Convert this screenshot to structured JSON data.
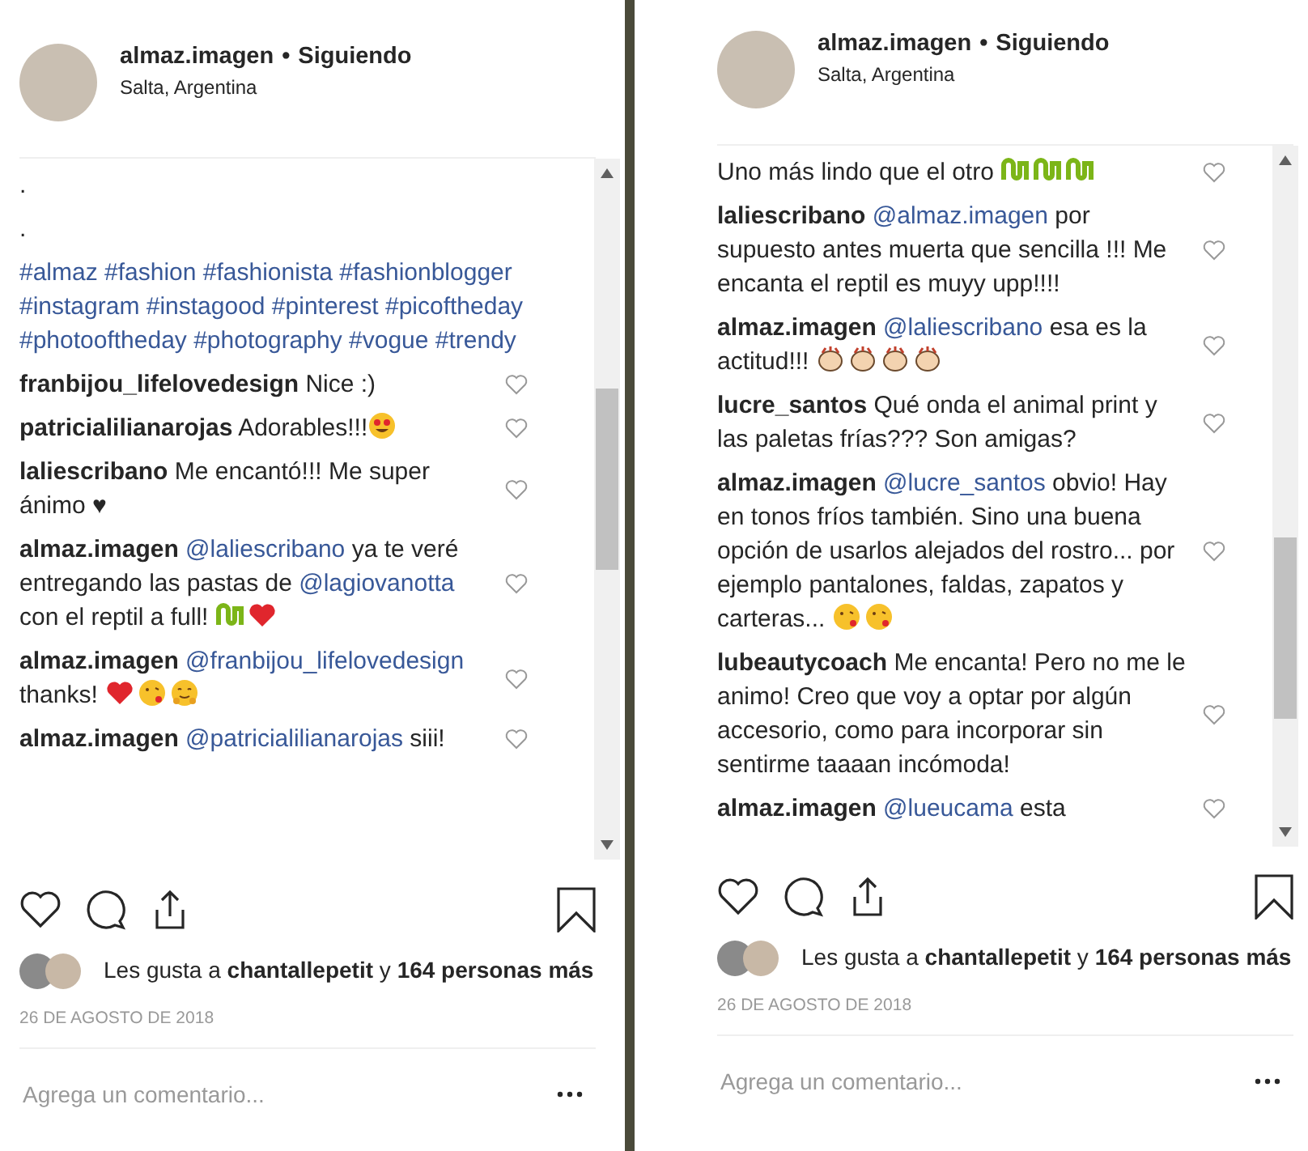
{
  "panels": [
    {
      "header": {
        "username": "almaz.imagen",
        "separator": "•",
        "follow": "Siguiendo",
        "location": "Salta, Argentina"
      },
      "comments": [
        {
          "kind": "caption",
          "parts": [
            {
              "kind": "text",
              "text": "."
            }
          ]
        },
        {
          "kind": "caption",
          "parts": [
            {
              "kind": "text",
              "text": "."
            }
          ]
        },
        {
          "kind": "caption",
          "parts": [
            {
              "kind": "tag",
              "text": "#almaz #fashion #fashionista #fashionblogger #instagram #instagood #pinterest #picoftheday #photooftheday #photography #vogue #trendy"
            }
          ]
        },
        {
          "kind": "comment",
          "user": "franbijou_lifelovedesign",
          "parts": [
            {
              "kind": "text",
              "text": "Nice :)"
            }
          ]
        },
        {
          "kind": "comment",
          "user": "patricialilianarojas",
          "parts": [
            {
              "kind": "text",
              "text": "Adorables!!!"
            }
          ],
          "stickers": [
            {
              "kind": "heart-eyes"
            }
          ]
        },
        {
          "kind": "comment",
          "user": "laliescribano",
          "parts": [
            {
              "kind": "text",
              "text": "Me encantó!!! Me super ánimo ♥"
            }
          ]
        },
        {
          "kind": "comment",
          "user": "almaz.imagen",
          "parts": [
            {
              "kind": "tag",
              "text": "@laliescribano"
            },
            {
              "kind": "text",
              "text": " ya te veré entregando las pastas de "
            },
            {
              "kind": "tag",
              "text": "@lagiovanotta"
            },
            {
              "kind": "text",
              "text": " con el reptil a full! "
            }
          ],
          "stickers": [
            {
              "kind": "snake"
            },
            {
              "kind": "heart"
            }
          ]
        },
        {
          "kind": "comment",
          "user": "almaz.imagen",
          "parts": [
            {
              "kind": "tag",
              "text": "@franbijou_lifelovedesign"
            },
            {
              "kind": "text",
              "text": " thanks! "
            }
          ],
          "stickers": [
            {
              "kind": "heart"
            },
            {
              "kind": "kiss"
            },
            {
              "kind": "hug"
            }
          ]
        },
        {
          "kind": "comment",
          "user": "almaz.imagen",
          "parts": [
            {
              "kind": "tag",
              "text": "@patricialilianarojas"
            },
            {
              "kind": "text",
              "text": " siii!"
            }
          ]
        }
      ],
      "likes": "Les gusta a **chantallepetit** y **164 personas más**",
      "date": "26 DE AGOSTO DE 2018",
      "input": {
        "placeholder": "Agrega un comentario..."
      }
    },
    {
      "header": {
        "username": "almaz.imagen",
        "separator": "•",
        "follow": "Siguiendo",
        "location": "Salta, Argentina"
      },
      "comments": [
        {
          "kind": "comment",
          "parts": [
            {
              "kind": "text",
              "text": "Uno más lindo que el otro "
            }
          ],
          "stickers": [
            {
              "kind": "snake"
            },
            {
              "kind": "snake"
            },
            {
              "kind": "snake"
            }
          ]
        },
        {
          "kind": "comment",
          "user": "laliescribano",
          "parts": [
            {
              "kind": "tag",
              "text": "@almaz.imagen"
            },
            {
              "kind": "text",
              "text": " por supuesto antes muerta que sencilla !!! Me encanta el reptil es muyy upp!!!!"
            }
          ]
        },
        {
          "kind": "comment",
          "user": "almaz.imagen",
          "parts": [
            {
              "kind": "tag",
              "text": "@laliescribano"
            },
            {
              "kind": "text",
              "text": " esa es la actitud!!! "
            }
          ],
          "stickers": [
            {
              "kind": "clap"
            },
            {
              "kind": "clap"
            },
            {
              "kind": "clap"
            },
            {
              "kind": "clap"
            }
          ]
        },
        {
          "kind": "comment",
          "user": "lucre_santos",
          "parts": [
            {
              "kind": "text",
              "text": "Qué onda el animal print y las paletas frías??? Son amigas?"
            }
          ]
        },
        {
          "kind": "comment",
          "user": "almaz.imagen",
          "parts": [
            {
              "kind": "tag",
              "text": "@lucre_santos"
            },
            {
              "kind": "text",
              "text": " obvio! Hay en tonos fríos también. Sino una buena opción de usarlos alejados del rostro... por ejemplo pantalones, faldas, zapatos y carteras... "
            }
          ],
          "stickers": [
            {
              "kind": "kiss"
            },
            {
              "kind": "kiss"
            }
          ]
        },
        {
          "kind": "comment",
          "user": "lubeautycoach",
          "parts": [
            {
              "kind": "text",
              "text": "Me encanta! Pero no me le animo! Creo que voy a optar por algún accesorio, como para incorporar sin sentirme taaaan incómoda!"
            }
          ]
        },
        {
          "kind": "comment",
          "user": "almaz.imagen",
          "parts": [
            {
              "kind": "tag",
              "text": "@lueucama"
            },
            {
              "kind": "text",
              "text": " esta"
            }
          ]
        }
      ],
      "likes": "Les gusta a **chantallepetit** y **164 personas más**",
      "date": "26 DE AGOSTO DE 2018",
      "input": {
        "placeholder": "Agrega un comentario..."
      }
    }
  ]
}
